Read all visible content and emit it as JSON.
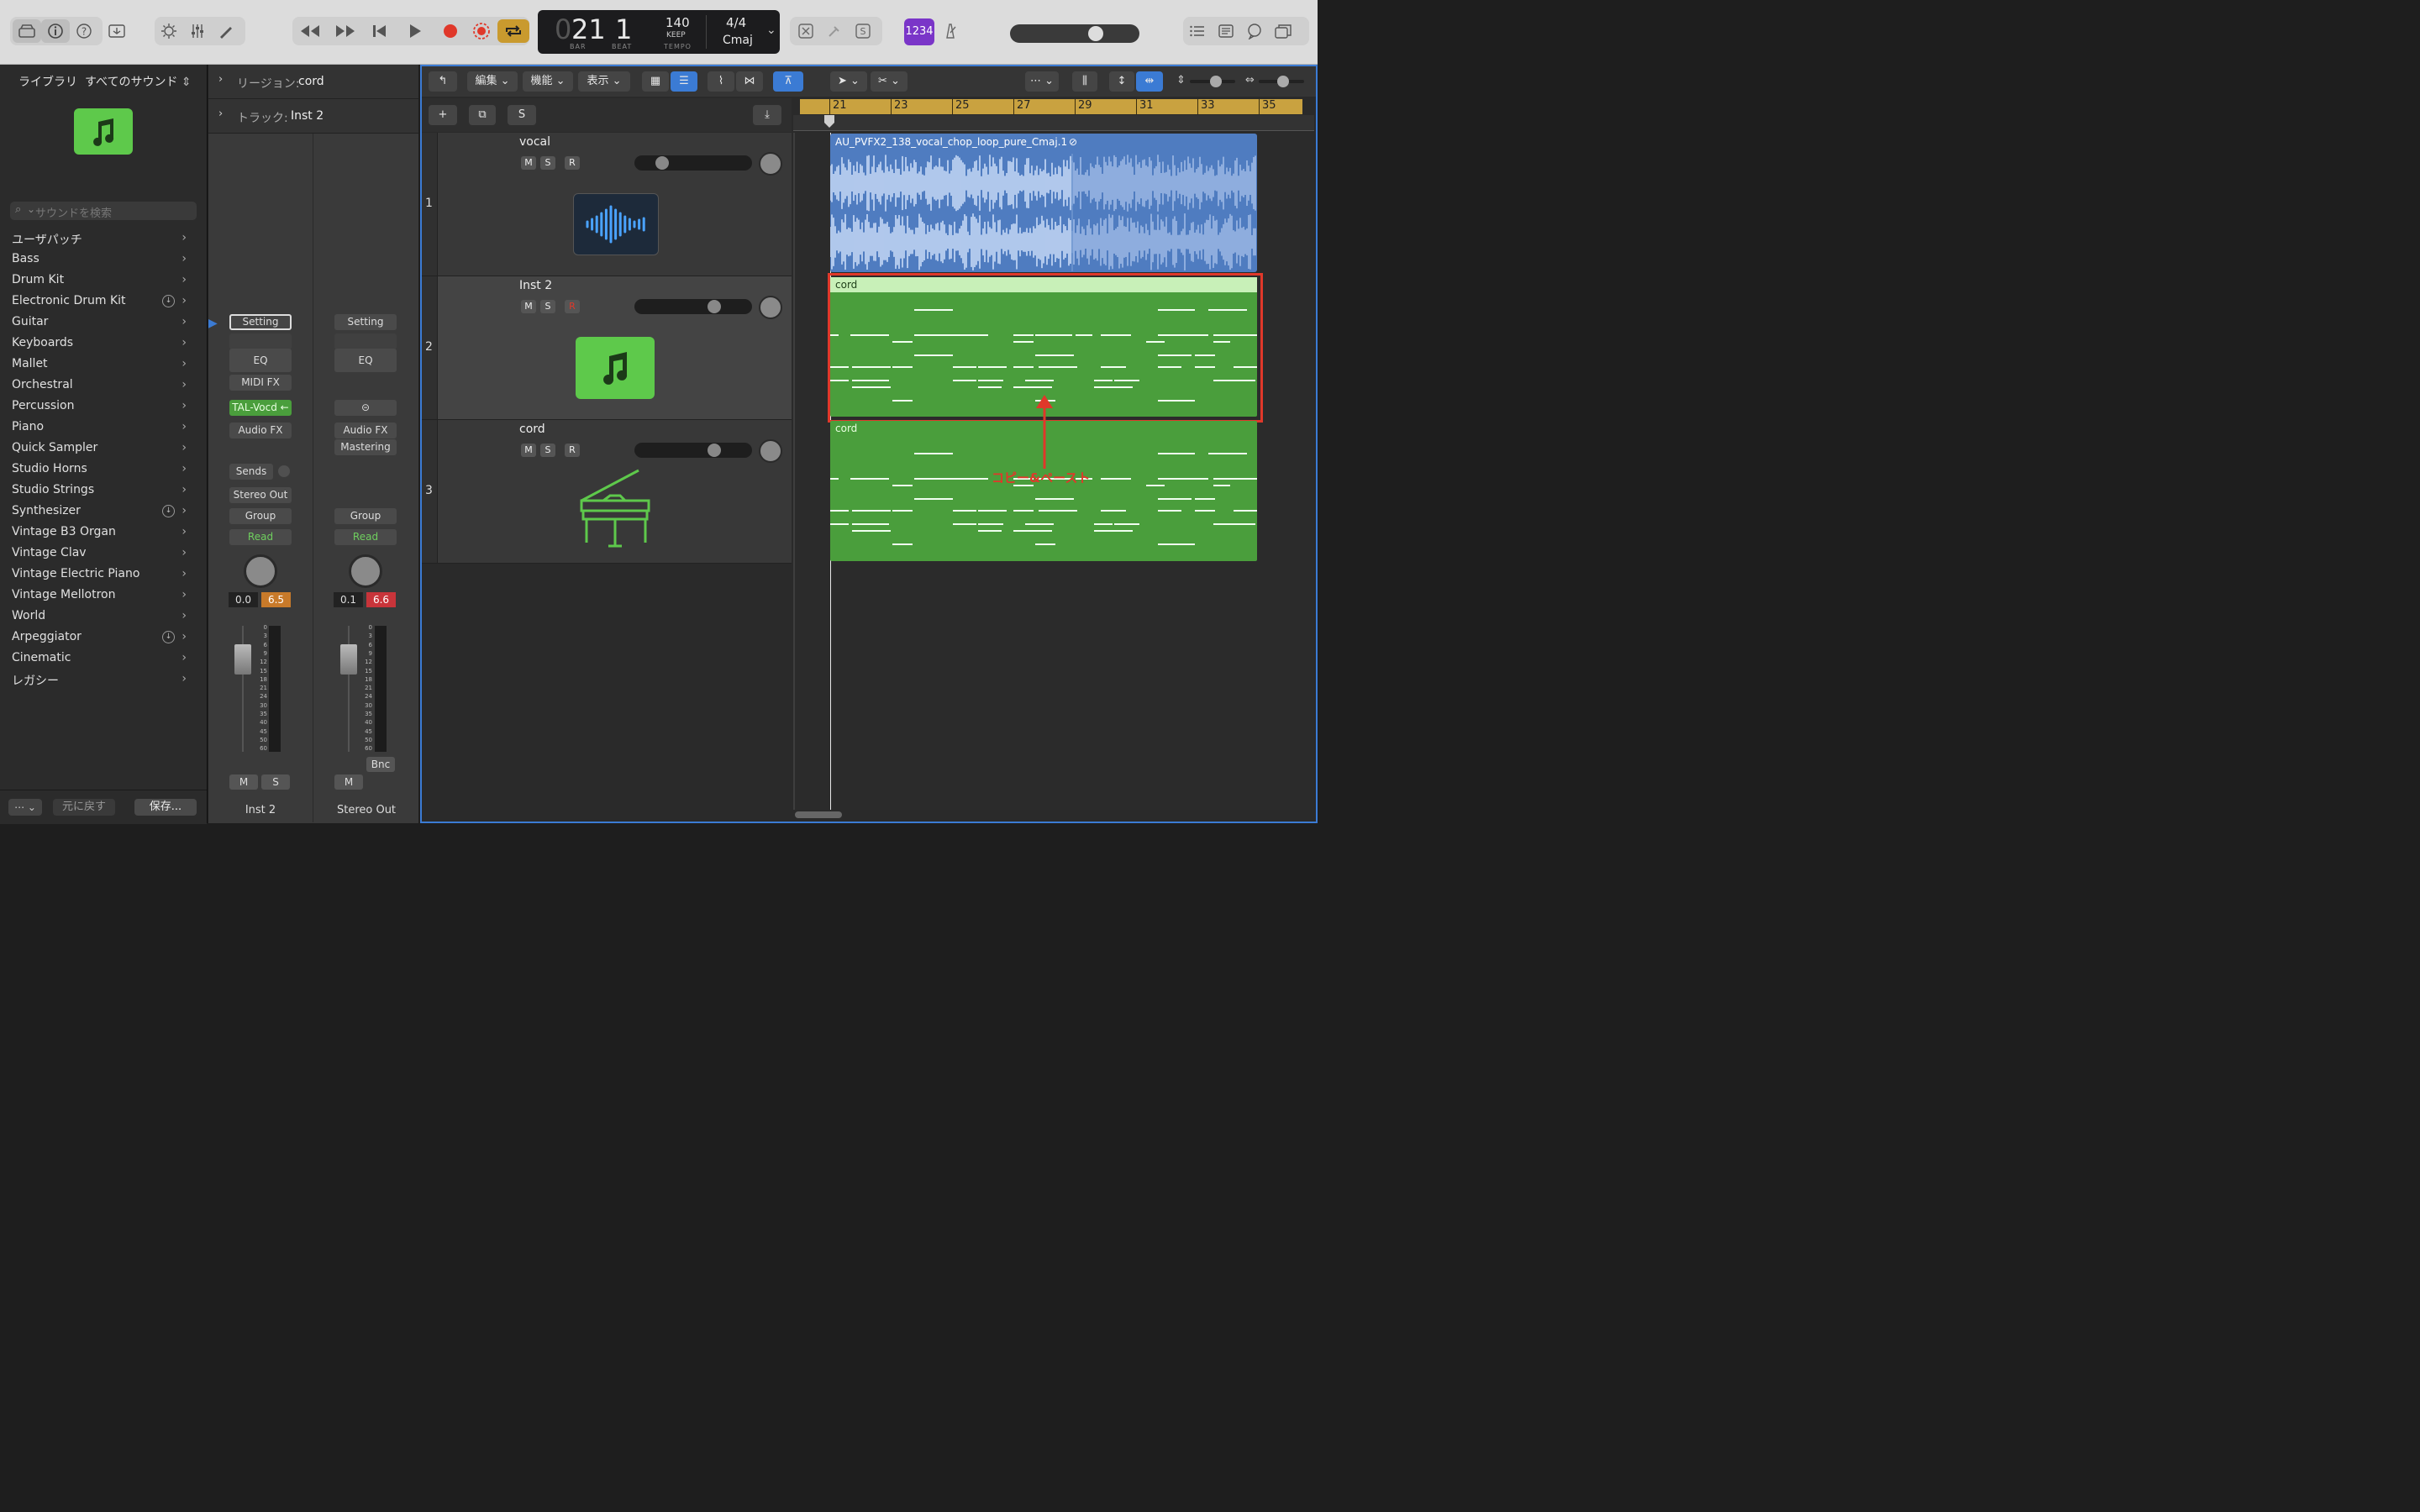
{
  "lcd": {
    "bar_prefix": "0",
    "bar": "21",
    "beat": "1",
    "bar_label": "BAR",
    "beat_label": "BEAT",
    "tempo": "140",
    "tempo_mode": "KEEP",
    "tempo_label": "TEMPO",
    "signature": "4/4",
    "key": "Cmaj"
  },
  "toolbar": {
    "count_in": "1234",
    "volume_level": 0.8
  },
  "library": {
    "header": "ライブラリ",
    "filter": "すべてのサウンド",
    "search_placeholder": "サウンドを検索",
    "items": [
      {
        "label": "ユーザパッチ"
      },
      {
        "label": "Bass"
      },
      {
        "label": "Drum Kit"
      },
      {
        "label": "Electronic Drum Kit",
        "download": true
      },
      {
        "label": "Guitar"
      },
      {
        "label": "Keyboards"
      },
      {
        "label": "Mallet"
      },
      {
        "label": "Orchestral"
      },
      {
        "label": "Percussion"
      },
      {
        "label": "Piano"
      },
      {
        "label": "Quick Sampler"
      },
      {
        "label": "Studio Horns"
      },
      {
        "label": "Studio Strings"
      },
      {
        "label": "Synthesizer",
        "download": true
      },
      {
        "label": "Vintage B3 Organ"
      },
      {
        "label": "Vintage Clav"
      },
      {
        "label": "Vintage Electric Piano"
      },
      {
        "label": "Vintage Mellotron"
      },
      {
        "label": "World"
      },
      {
        "label": "Arpeggiator",
        "download": true
      },
      {
        "label": "Cinematic"
      },
      {
        "label": "レガシー"
      }
    ],
    "revert": "元に戻す",
    "save": "保存..."
  },
  "inspector": {
    "region_label": "リージョン:",
    "region_name": "cord",
    "track_label": "トラック:",
    "track_name": "Inst 2",
    "strip1": {
      "setting": "Setting",
      "eq": "EQ",
      "midi_fx": "MIDI FX",
      "plugin": "TAL-Vocd ←",
      "audio_fx": "Audio FX",
      "sends": "Sends",
      "output": "Stereo Out",
      "group": "Group",
      "automation": "Read",
      "val1": "0.0",
      "val2": "6.5",
      "mute": "M",
      "solo": "S",
      "name": "Inst 2"
    },
    "strip2": {
      "setting": "Setting",
      "eq": "EQ",
      "audio_fx": "Audio FX",
      "mastering": "Mastering",
      "group": "Group",
      "automation": "Read",
      "val1": "0.1",
      "val2": "6.6",
      "bounce": "Bnc",
      "mute": "M",
      "name": "Stereo Out"
    },
    "scale": [
      "0",
      "3",
      "6",
      "9",
      "12",
      "15",
      "18",
      "21",
      "24",
      "30",
      "35",
      "40",
      "45",
      "50",
      "60"
    ]
  },
  "tracks_toolbar": {
    "edit": "編集",
    "functions": "機能",
    "view": "表示",
    "solo_btn": "S"
  },
  "ruler": [
    "21",
    "23",
    "25",
    "27",
    "29",
    "31",
    "33",
    "35"
  ],
  "tracks": [
    {
      "num": "1",
      "name": "vocal",
      "mute": "M",
      "solo": "S",
      "rec": "R",
      "volume": 0.2,
      "region": "AU_PVFX2_138_vocal_chop_loop_pure_Cmaj.1"
    },
    {
      "num": "2",
      "name": "Inst 2",
      "mute": "M",
      "solo": "S",
      "rec": "R",
      "volume": 0.7,
      "region": "cord"
    },
    {
      "num": "3",
      "name": "cord",
      "mute": "M",
      "solo": "S",
      "rec": "R",
      "volume": 0.7,
      "region": "cord"
    }
  ],
  "annotation": "コピー&ペースト",
  "colors": {
    "accent": "#3b7bd4",
    "midi_region": "#4a9e3c",
    "audio_region": "#4f7cc0",
    "ruler": "#c9a240",
    "highlight": "#e0382a"
  }
}
